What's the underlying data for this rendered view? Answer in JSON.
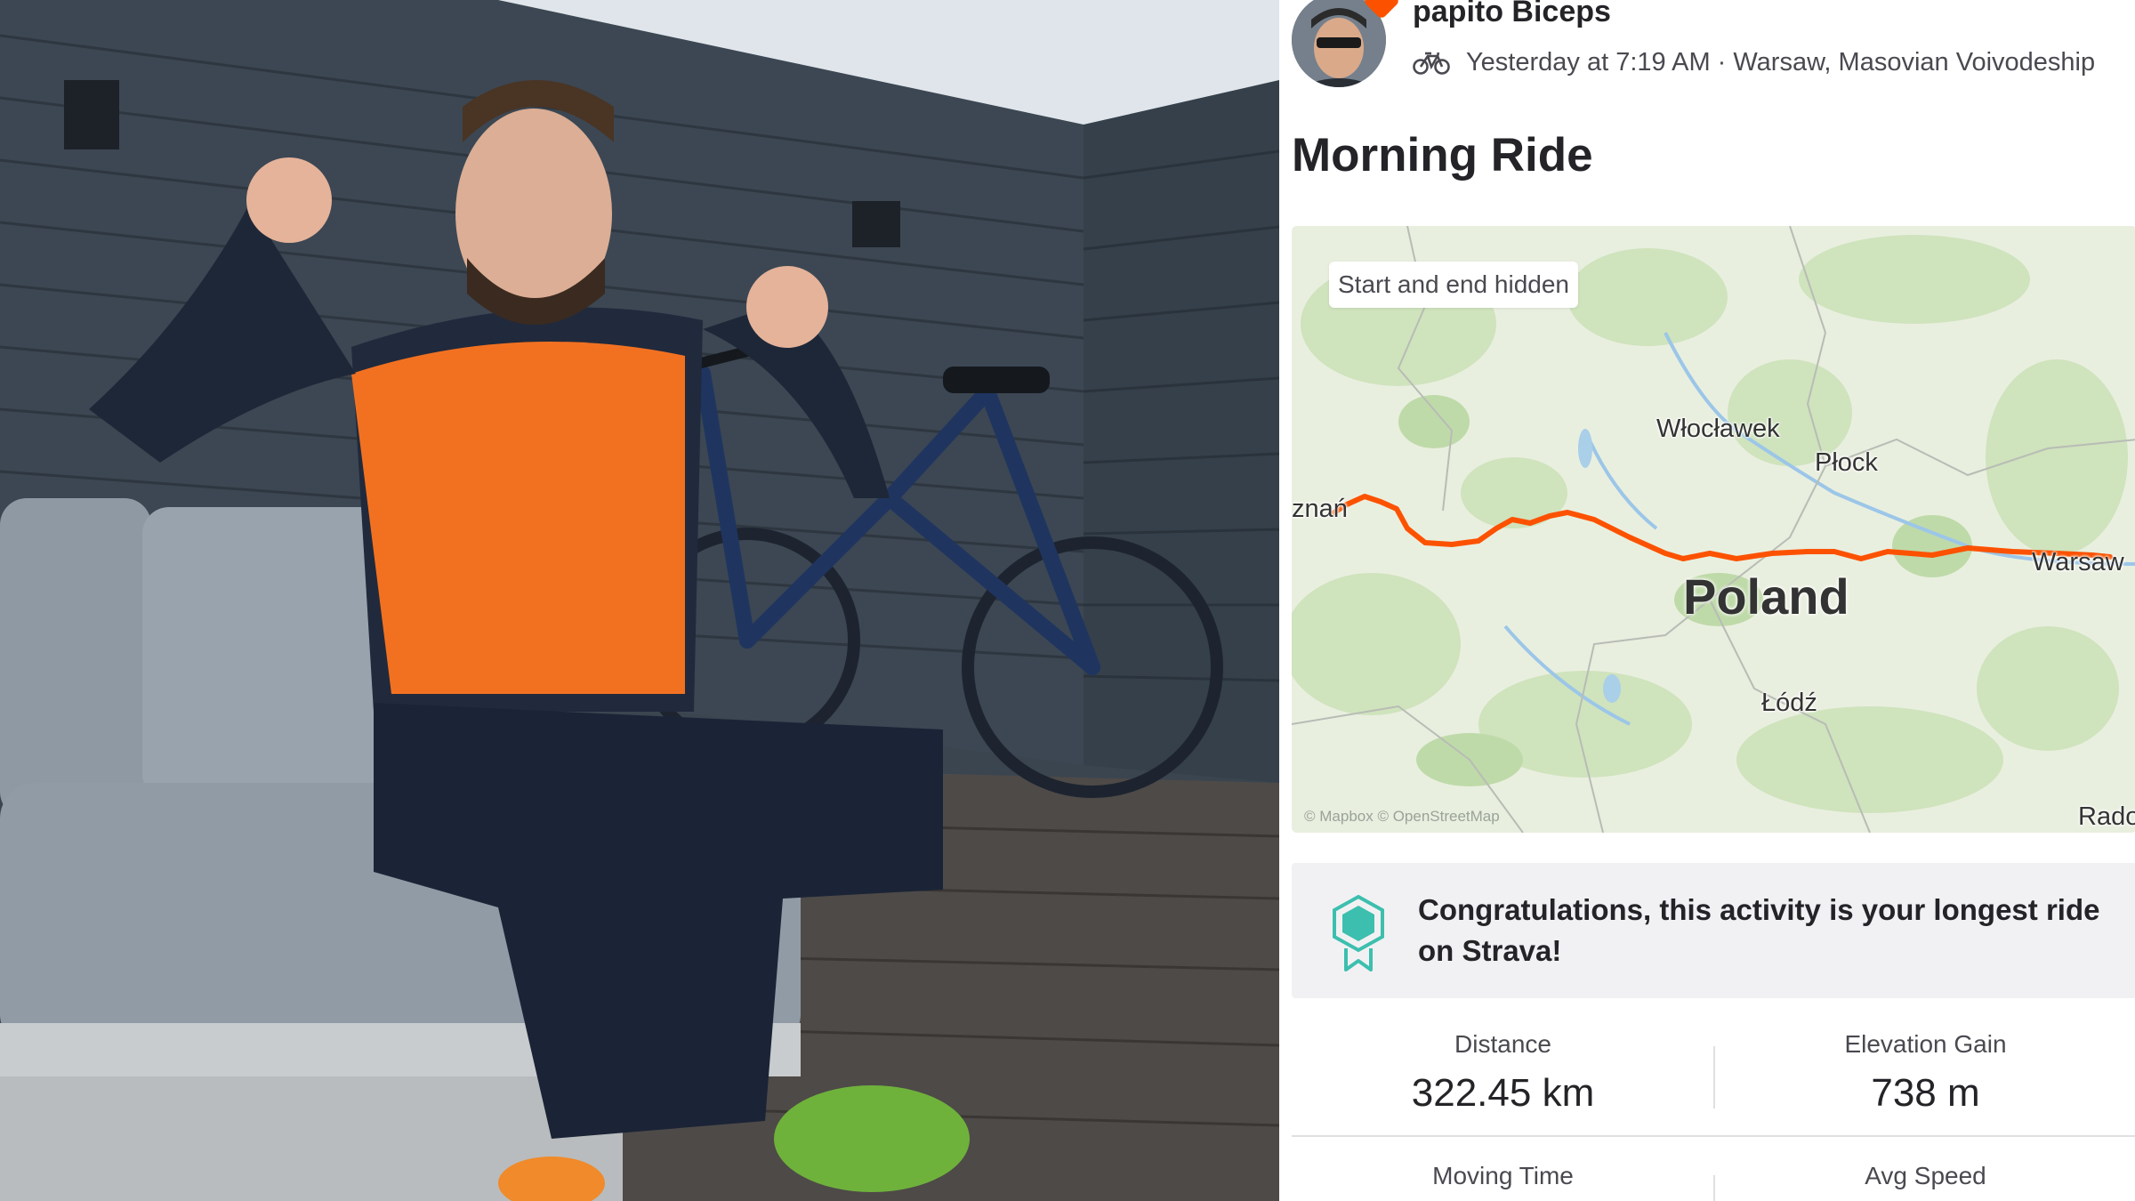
{
  "athlete": {
    "name": "papito Biceps",
    "activity_icon": "bike-icon",
    "meta": "Yesterday at 7:19 AM · Warsaw, Masovian Voivodeship"
  },
  "activity": {
    "title": "Morning Ride"
  },
  "map": {
    "privacy_chip": "Start and end hidden",
    "labels": {
      "wloclawek": "Włocławek",
      "plock": "Płock",
      "poznan": "znań",
      "warsaw": "Warsaw",
      "lodz": "Łódź",
      "radom": "Rado",
      "country": "Poland"
    },
    "attribution": "© Mapbox © OpenStreetMap",
    "route_color": "#fc5200"
  },
  "achievement": {
    "icon": "achievement-medal-icon",
    "text": "Congratulations, this activity is your longest ride on Strava!",
    "icon_color": "#3cbfae"
  },
  "stats": [
    {
      "label": "Distance",
      "value": "322.45 km"
    },
    {
      "label": "Elevation Gain",
      "value": "738 m"
    },
    {
      "label": "Moving Time",
      "value": ""
    },
    {
      "label": "Avg Speed",
      "value": ""
    }
  ],
  "colors": {
    "accent": "#fc5200",
    "text_primary": "#242428",
    "text_secondary": "#494950"
  }
}
